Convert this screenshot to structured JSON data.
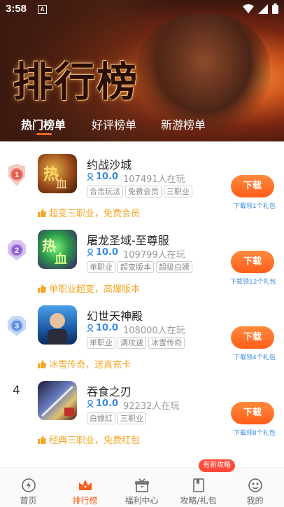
{
  "status_bar": {
    "time": "3:58",
    "sim_label": "A"
  },
  "hero": {
    "title": "排行榜"
  },
  "tabs": [
    {
      "label": "热门榜单",
      "active": true
    },
    {
      "label": "好评榜单",
      "active": false
    },
    {
      "label": "新游榜单",
      "active": false
    }
  ],
  "items": [
    {
      "rank": "1",
      "name": "约战沙城",
      "score": "10.0",
      "players": "107491人在玩",
      "tags": [
        "合击玩法",
        "免费会员",
        "三职业"
      ],
      "button": "下载",
      "gift": "下载领1个礼包",
      "promo": "超变三职业，免费会员"
    },
    {
      "rank": "2",
      "name": "屠龙圣域-至尊服",
      "score": "10.0",
      "players": "109799人在玩",
      "tags": [
        "单职业",
        "超变版本",
        "超级白嫖"
      ],
      "button": "下载",
      "gift": "下载领12个礼包",
      "promo": "单职业超变，高爆版本"
    },
    {
      "rank": "3",
      "name": "幻世天神殿",
      "score": "10.0",
      "players": "108000人在玩",
      "tags": [
        "单职业",
        "满攻速",
        "冰雪传奇"
      ],
      "button": "下载",
      "gift": "下载领4个礼包",
      "promo": "冰雪传奇，送真充卡"
    },
    {
      "rank": "4",
      "name": "吞食之刃",
      "score": "10.0",
      "players": "92232人在玩",
      "tags": [
        "白嫖红",
        "三职业"
      ],
      "button": "下载",
      "gift": "下载领8个礼包",
      "promo": "经典三职业，免费红包"
    }
  ],
  "nav": [
    {
      "label": "首页",
      "icon": "home-icon"
    },
    {
      "label": "排行榜",
      "icon": "crown-icon",
      "active": true
    },
    {
      "label": "福利中心",
      "icon": "gift-icon"
    },
    {
      "label": "攻略/礼包",
      "icon": "book-icon"
    },
    {
      "label": "我的",
      "icon": "user-icon"
    }
  ],
  "nav_badge": "有新攻略",
  "colors": {
    "accent": "#ff5e1a",
    "score_blue": "#3a8dde",
    "promo_yellow": "#f5a623"
  }
}
